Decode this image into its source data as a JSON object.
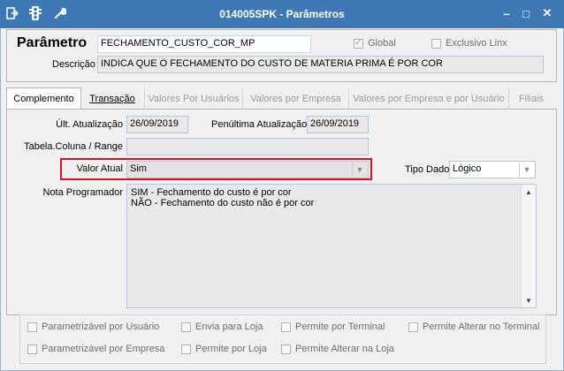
{
  "window": {
    "title": "014005SPK - Parâmetros",
    "icons": [
      "exit-icon",
      "traffic-light-icon",
      "wrench-icon"
    ],
    "controls": {
      "minimize": "–",
      "maximize": "□",
      "close": "✕"
    }
  },
  "header": {
    "parametro_label": "Parâmetro",
    "parametro_value": "FECHAMENTO_CUSTO_COR_MP",
    "global_label": "Global",
    "global_checked": true,
    "exclusivo_label": "Exclusivo Linx",
    "exclusivo_checked": false,
    "descricao_label": "Descrição",
    "descricao_value": "INDICA QUE O FECHAMENTO DO CUSTO DE MATERIA PRIMA É POR COR"
  },
  "tabs": [
    {
      "label": "Complemento",
      "active": true
    },
    {
      "label": "Transação",
      "active": false
    },
    {
      "label": "Valores Por Usuários",
      "active": false
    },
    {
      "label": "Valores por Empresa",
      "active": false
    },
    {
      "label": "Valores por Empresa e por Usuário",
      "active": false
    },
    {
      "label": "Filiais",
      "active": false
    }
  ],
  "complemento": {
    "ult_atualizacao_label": "Últ. Atualização",
    "ult_atualizacao_value": "26/09/2019",
    "penultima_label": "Penúltima Atualização",
    "penultima_value": "26/09/2019",
    "tabela_label": "Tabela.Coluna / Range",
    "tabela_value": "",
    "valor_atual_label": "Valor Atual",
    "valor_atual_value": "Sim",
    "tipo_dado_label": "Tipo Dado",
    "tipo_dado_value": "Lógico",
    "nota_label": "Nota Programador",
    "nota_lines": [
      "SIM - Fechamento do custo é por cor",
      "NÃO - Fechamento do custo não é por cor"
    ],
    "highlight_color": "#e0101a"
  },
  "options": [
    {
      "label": "Parametrizável por Usuário",
      "checked": false
    },
    {
      "label": "Envia para Loja",
      "checked": false
    },
    {
      "label": "Permite por Terminal",
      "checked": false
    },
    {
      "label": "Permite Alterar no Terminal",
      "checked": false
    },
    {
      "label": "Parametrizável por Empresa",
      "checked": false
    },
    {
      "label": "Permite por Loja",
      "checked": false
    },
    {
      "label": "Permite Alterar na Loja",
      "checked": false
    }
  ]
}
